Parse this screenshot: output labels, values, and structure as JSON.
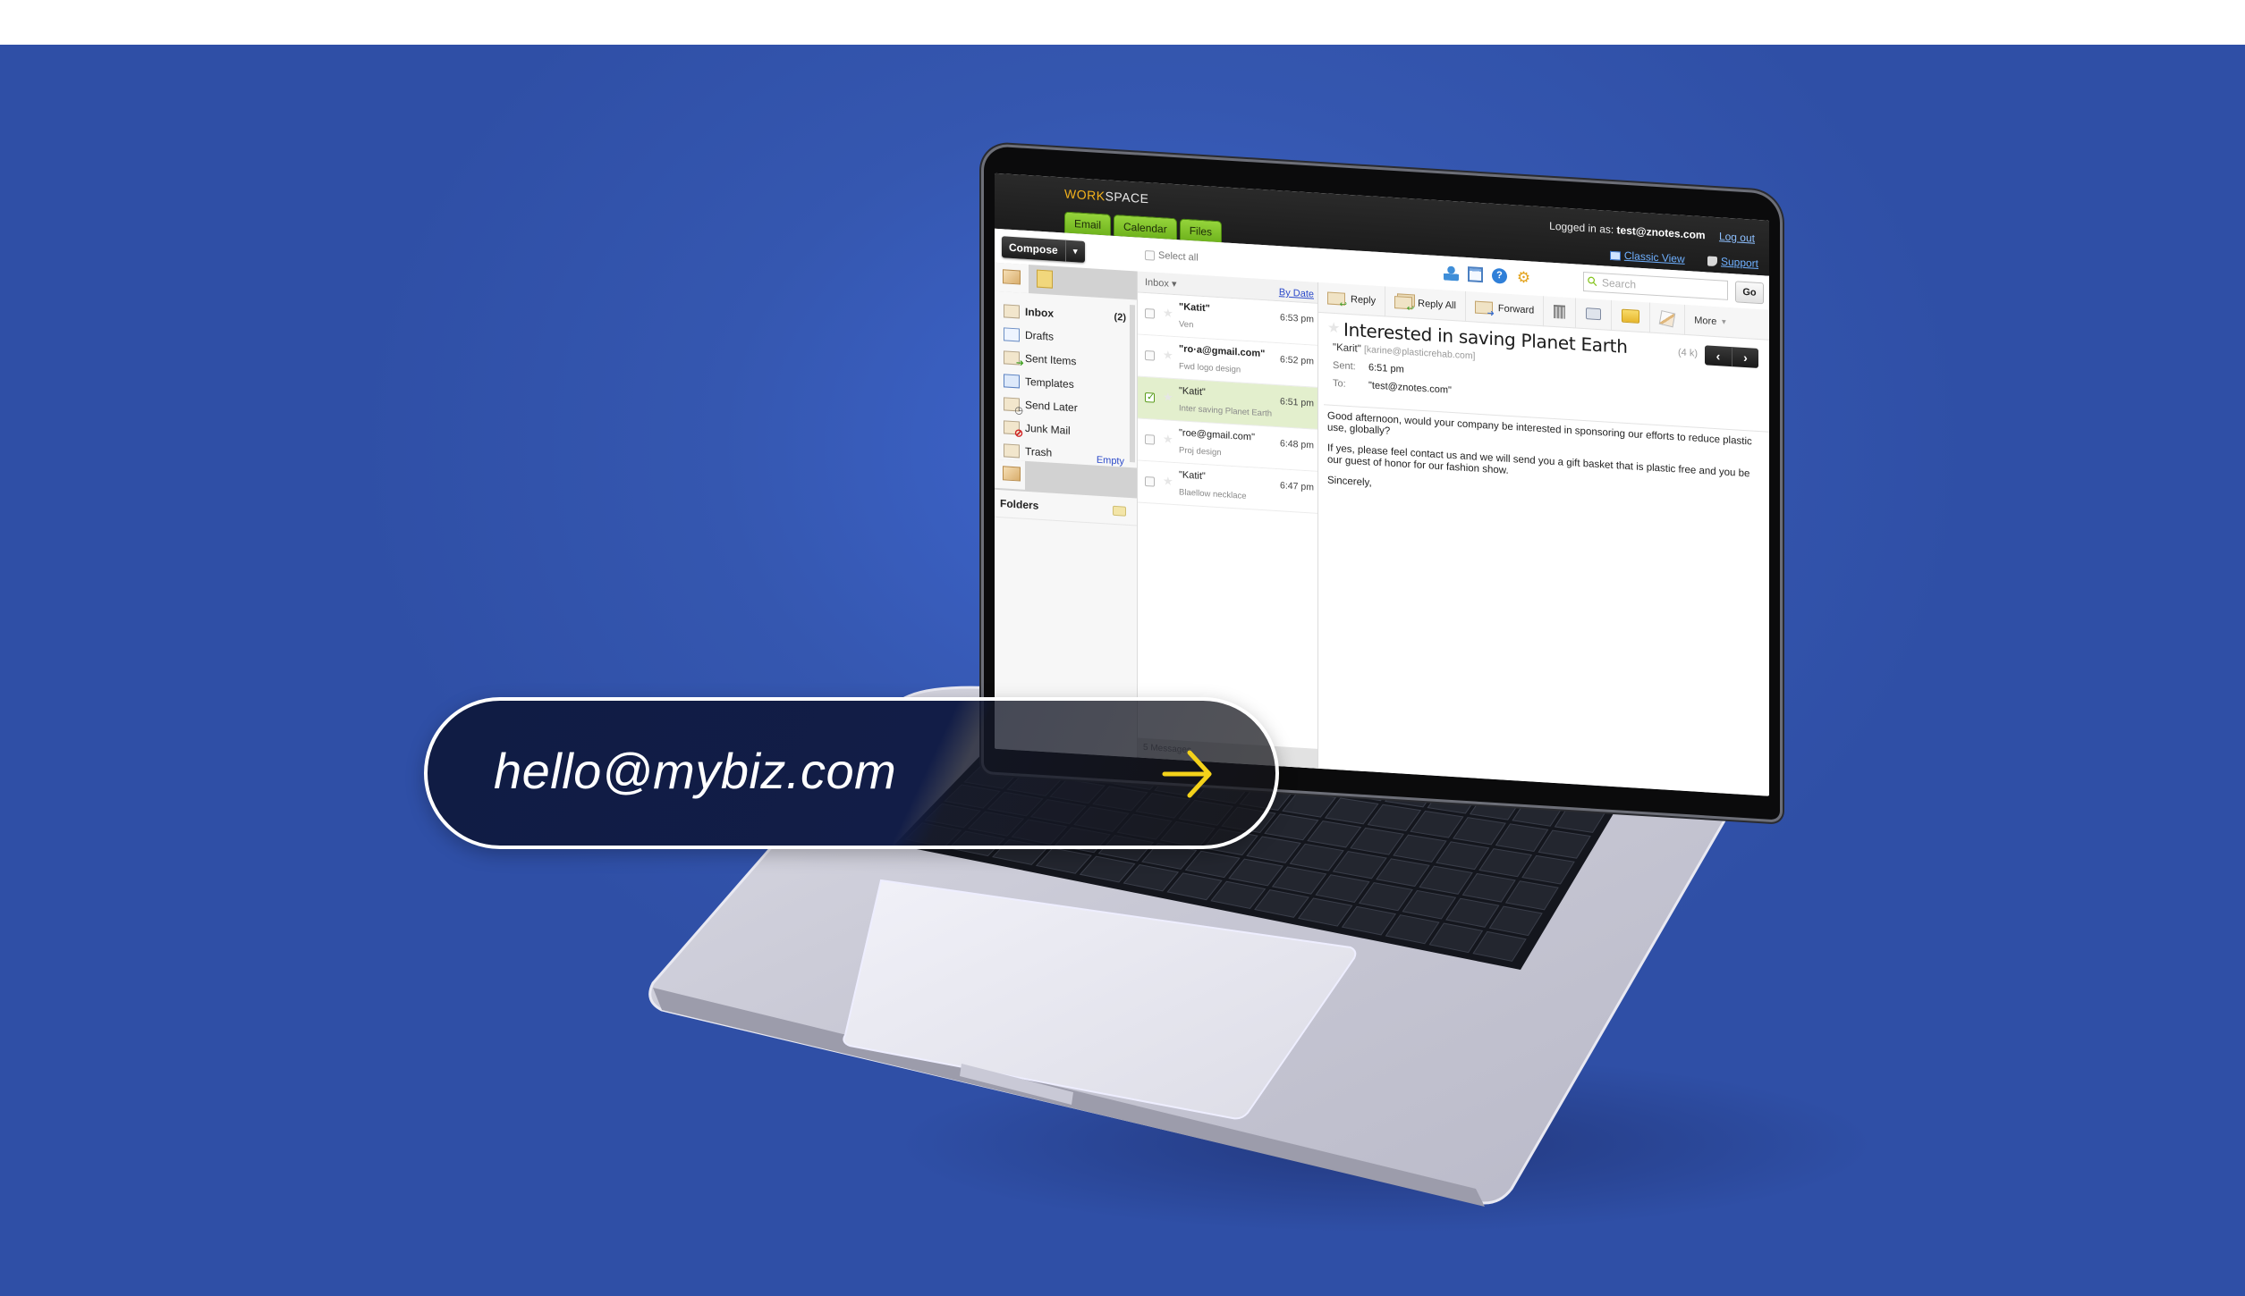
{
  "app": {
    "brand_accent": "WORK",
    "brand_rest": "SPACE",
    "logged_in_label": "Logged in as:",
    "logged_in_user": "test@znotes.com",
    "logout_label": "Log out",
    "classic_view_label": "Classic View",
    "support_label": "Support",
    "tabs": [
      {
        "label": "Email"
      },
      {
        "label": "Calendar"
      },
      {
        "label": "Files"
      }
    ],
    "compose_label": "Compose",
    "select_all_label": "Select all",
    "search_placeholder": "Search",
    "go_label": "Go",
    "toolbar_icons": [
      "contacts-icon",
      "layout-icon",
      "help-icon",
      "settings-icon"
    ]
  },
  "folders": {
    "items": [
      {
        "label": "Inbox",
        "count": "(2)",
        "icon": "inbox-icon"
      },
      {
        "label": "Drafts",
        "count": "",
        "icon": "drafts-icon"
      },
      {
        "label": "Sent Items",
        "count": "",
        "icon": "sent-icon"
      },
      {
        "label": "Templates",
        "count": "",
        "icon": "templates-icon"
      },
      {
        "label": "Send Later",
        "count": "",
        "icon": "send-later-icon"
      },
      {
        "label": "Junk Mail",
        "count": "",
        "icon": "junk-icon"
      },
      {
        "label": "Trash",
        "count": "",
        "icon": "trash-icon"
      }
    ],
    "empty_label": "Empty",
    "folders_title": "Folders"
  },
  "message_list": {
    "folder_selector": "Inbox",
    "sort_label": "By Date",
    "messages": [
      {
        "from": "\"Katit\"",
        "subject": "Ven",
        "time": "6:53 pm",
        "unread": true,
        "selected": false
      },
      {
        "from": "\"ro·a@gmail.com\"",
        "subject": "Fwd logo design",
        "time": "6:52 pm",
        "unread": true,
        "selected": false
      },
      {
        "from": "\"Katit\"",
        "subject": "Inter saving Planet Earth",
        "time": "6:51 pm",
        "unread": false,
        "selected": true
      },
      {
        "from": "\"roe@gmail.com\"",
        "subject": "Proj design",
        "time": "6:48 pm",
        "unread": false,
        "selected": false
      },
      {
        "from": "\"Katit\"",
        "subject": "Blaellow necklace",
        "time": "6:47 pm",
        "unread": false,
        "selected": false
      }
    ],
    "footer": "5 Messages"
  },
  "reader": {
    "toolbar": {
      "reply": "Reply",
      "reply_all": "Reply All",
      "forward": "Forward",
      "more": "More"
    },
    "subject": "Interested in saving Planet Earth",
    "size": "(4 k)",
    "sender_name": "\"Karit\"",
    "sender_address": "[karine@plasticrehab.com]",
    "sent_label": "Sent:",
    "sent_value": "6:51 pm",
    "to_label": "To:",
    "to_value": "\"test@znotes.com\"",
    "body": [
      "Good afternoon, would your company be interested in sponsoring our efforts to reduce plastic use, globally?",
      "If yes, please feel contact us and we will send you a gift basket that is plastic free and you be our guest of honor for our fashion show.",
      "Sincerely,"
    ]
  },
  "overlay": {
    "email": "hello@mybiz.com",
    "arrow_color": "#f4d21a"
  },
  "colors": {
    "background": "#3557b0",
    "tab_green": "#7dbf27",
    "selected_row": "#e3efcd",
    "pill_bg": "#111c46"
  }
}
